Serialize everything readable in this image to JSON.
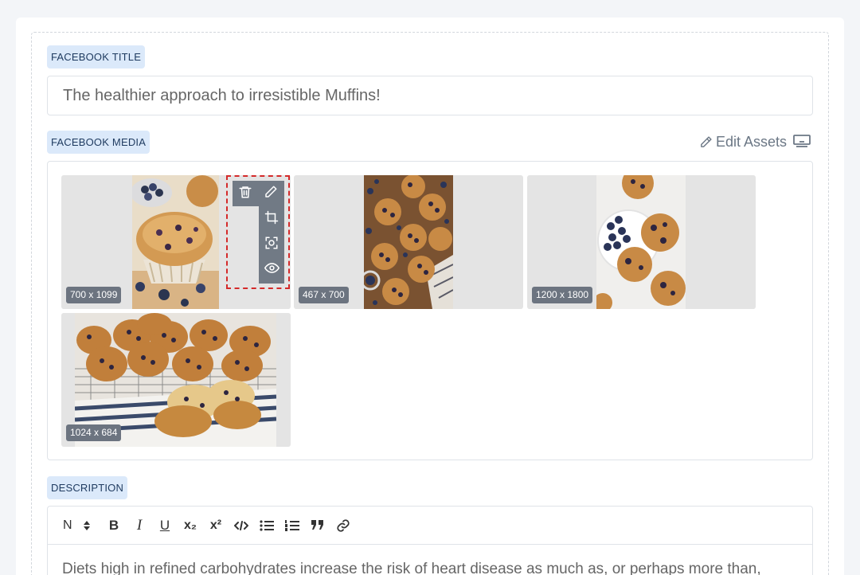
{
  "facebook_title": {
    "label": "FACEBOOK TITLE",
    "value": "The healthier approach to irresistible Muffins!"
  },
  "facebook_media": {
    "label": "FACEBOOK MEDIA",
    "edit_assets_label": "Edit Assets",
    "images": [
      {
        "dimensions": "700 x 1099"
      },
      {
        "dimensions": "467 x 700"
      },
      {
        "dimensions": "1200 x 1800"
      },
      {
        "dimensions": "1024 x 684"
      }
    ],
    "tools": [
      "trash-icon",
      "pencil-icon",
      "crop-icon",
      "focus-icon",
      "eye-icon"
    ]
  },
  "description": {
    "label": "DESCRIPTION",
    "toolbar": {
      "heading": "N",
      "bold": "B",
      "italic": "I",
      "underline": "U",
      "subscript": "x₂",
      "superscript": "x²"
    },
    "text": "Diets high in refined carbohydrates increase the risk of heart disease as much as, or perhaps more than,"
  },
  "colors": {
    "label_bg": "#dbe9fa",
    "label_text": "#1e3a5f",
    "badge_bg": "#6c7480",
    "tool_bg": "#717a85",
    "highlight": "#d42a2a"
  }
}
